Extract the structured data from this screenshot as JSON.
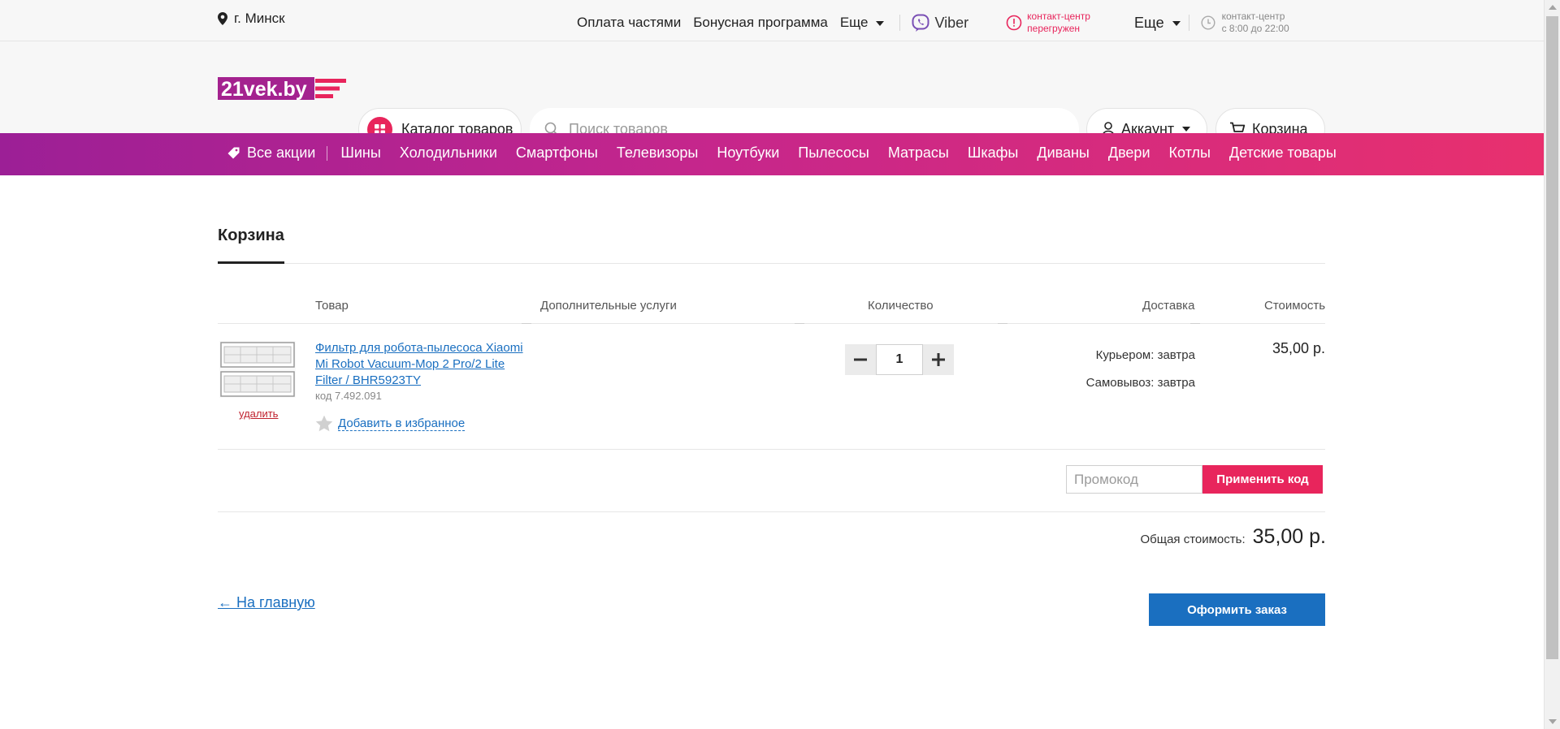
{
  "topbar": {
    "city": "г. Минск",
    "nav": [
      "Оплата частями",
      "Бонусная программа",
      "Еще"
    ],
    "viber": "Viber",
    "contact_alert_line1": "контакт-центр",
    "contact_alert_line2": "перегружен",
    "more": "Еще",
    "hours_line1": "контакт-центр",
    "hours_line2": "с 8:00 до 22:00"
  },
  "header": {
    "logo_text": "21vek.by",
    "catalog_label": "Каталог товаров",
    "search_placeholder": "Поиск товаров",
    "account_label": "Аккаунт",
    "cart_label": "Корзина"
  },
  "promobar": {
    "all_label": "Все акции",
    "categories": [
      "Шины",
      "Холодильники",
      "Смартфоны",
      "Телевизоры",
      "Ноутбуки",
      "Пылесосы",
      "Матрасы",
      "Шкафы",
      "Диваны",
      "Двери",
      "Котлы",
      "Детские товары"
    ]
  },
  "cart": {
    "title": "Корзина",
    "columns": {
      "product": "Товар",
      "services": "Дополнительные услуги",
      "quantity": "Количество",
      "delivery": "Доставка",
      "cost": "Стоимость"
    },
    "item": {
      "name": "Фильтр для робота-пылесоса Xiaomi Mi Robot Vacuum-Mop 2 Pro/2 Lite Filter / BHR5923TY",
      "code": "код 7.492.091",
      "delete": "удалить",
      "favorite": "Добавить в избранное",
      "quantity": "1",
      "delivery_courier": "Курьером: завтра",
      "delivery_pickup": "Самовывоз: завтра",
      "price": "35,00 р."
    },
    "promo_placeholder": "Промокод",
    "promo_apply": "Применить код",
    "total_label": "Общая стоимость:",
    "total_value": "35,00 р.",
    "home_link": "← На главную",
    "checkout": "Оформить заказ"
  },
  "colors": {
    "accent": "#e8255c",
    "link": "#1a6fc0",
    "promobar_start": "#9c1f96",
    "promobar_end": "#e8306e"
  }
}
